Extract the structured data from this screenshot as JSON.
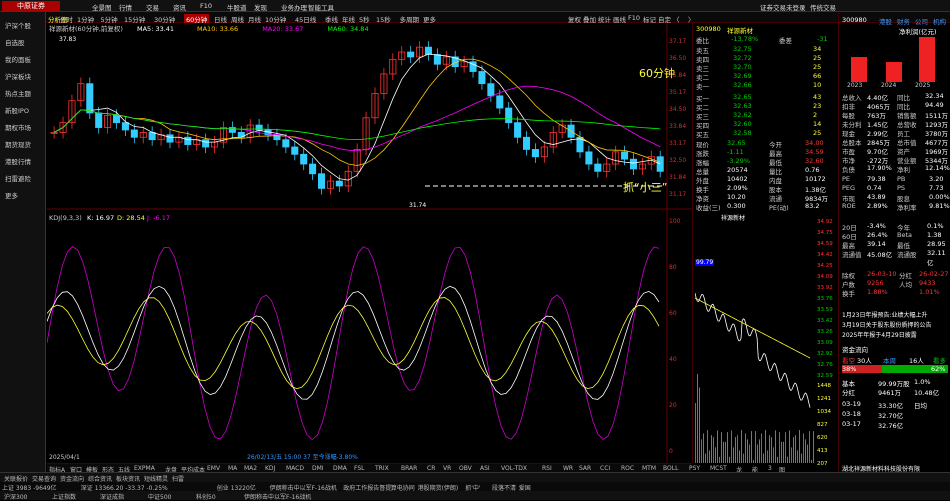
{
  "app": {
    "logo": "中原证券",
    "menus": [
      "全景图",
      "行情",
      "交易",
      "资讯",
      "F10",
      "牛股道",
      "发现",
      "业务办理",
      "智能工具"
    ],
    "right_menus": [
      "证券交易未登录",
      "传统交易"
    ]
  },
  "toolbar": {
    "ticker_label": "分析图",
    "timeframes": [
      "分时",
      "1分钟",
      "5分钟",
      "15分钟",
      "30分钟",
      "60分钟",
      "日线",
      "周线",
      "月线",
      "10分钟",
      "45日线",
      "季线",
      "年线",
      "5秒",
      "15秒",
      "多周期",
      "更多"
    ],
    "active_tf": "60分钟",
    "right_tools": [
      "复权",
      "叠加",
      "统计",
      "画线",
      "F10",
      "标记",
      "自定",
      "〈",
      "〉"
    ]
  },
  "sidebar": [
    "沪深个股",
    "自选股",
    "我的面板",
    "沪深板块",
    "热点主题",
    "新股IPO",
    "期权市场",
    "期货现货",
    "港股行情",
    "扫雷避险",
    "更多"
  ],
  "chart": {
    "title": "祥源新材(60分钟,前复权)",
    "ma": [
      {
        "label": "MA5: 33.41",
        "color": "#ffffff"
      },
      {
        "label": "MA10: 33.66",
        "color": "#ffcc00"
      },
      {
        "label": "MA20: 33.67",
        "color": "#ff00ff"
      },
      {
        "label": "MA60: 34.84",
        "color": "#00ff00"
      }
    ],
    "high_label": "37.83",
    "low_label": "31.74",
    "annotation_time": "60分钟",
    "annotation_grab": "抓“小三”",
    "kdj_label": "KDJ(9,3,3)",
    "k": "K: 16.97",
    "d": "D: 28.54",
    "j": "J: -6.17",
    "cursor_info": "26/02/13/五 15:00 37 至今涨幅-3.80%",
    "date_left": "2025/04/1",
    "y_ticks_price": [
      "37.17",
      "36.50",
      "35.84",
      "35.17",
      "34.50",
      "33.84",
      "33.17",
      "32.50",
      "31.84",
      "31.17"
    ],
    "y_ticks_kdj": [
      "100",
      "80",
      "60",
      "40",
      "20",
      "0"
    ]
  },
  "bottom_tabs": [
    "指标A",
    "窗口",
    "模板",
    "形态",
    "五线",
    "EXPMA",
    "龙盘",
    "平均成本",
    "EMV",
    "MA",
    "MA2",
    "KDJ",
    "MACD",
    "DMI",
    "DMA",
    "FSL",
    "TRIX",
    "BRAR",
    "CR",
    "VR",
    "OBV",
    "ASI",
    "VOL-TDX",
    "RSI",
    "WR",
    "SAR",
    "CCI",
    "ROC",
    "MTM",
    "BOLL",
    "PSY",
    "MCST",
    "龙线",
    "能量",
    "3",
    "图文"
  ],
  "quote": {
    "code": "300980",
    "name": "祥源新材",
    "wei_bi": "-13.78%",
    "wei_cha": "-31",
    "sells": [
      [
        "卖五",
        "32.75",
        "34"
      ],
      [
        "卖四",
        "32.72",
        "25"
      ],
      [
        "卖三",
        "32.70",
        "25"
      ],
      [
        "卖二",
        "32.69",
        "66"
      ],
      [
        "卖一",
        "32.66",
        "10"
      ]
    ],
    "buys": [
      [
        "买一",
        "32.65",
        "43"
      ],
      [
        "买二",
        "32.63",
        "23"
      ],
      [
        "买三",
        "32.62",
        "2"
      ],
      [
        "买四",
        "32.60",
        "14"
      ],
      [
        "买五",
        "32.58",
        "25"
      ]
    ],
    "stats": [
      [
        "现价",
        "32.65",
        "今开",
        "34.00"
      ],
      [
        "涨跌",
        "-1.11",
        "最高",
        "34.59"
      ],
      [
        "涨幅",
        "-3.29%",
        "最低",
        "32.60"
      ],
      [
        "总量",
        "20574",
        "量比",
        "0.76"
      ],
      [
        "外盘",
        "10402",
        "内盘",
        "10172"
      ],
      [
        "换手",
        "2.09%",
        "股本",
        "1.38亿"
      ],
      [
        "净资",
        "10.20",
        "流通",
        "9834万"
      ],
      [
        "收益(三)",
        "0.300",
        "PE(动)",
        "83.2"
      ]
    ],
    "axis": [
      "34.92",
      "34.75",
      "34.59",
      "34.42",
      "34.25",
      "34.09",
      "33.92",
      "33.76",
      "33.59",
      "33.42",
      "33.26",
      "33.09",
      "32.92",
      "32.76",
      "32.59"
    ],
    "vol_axis": [
      "1448",
      "1241",
      "1034",
      "827",
      "620",
      "413",
      "207"
    ],
    "mini_label": "祥源新材",
    "mini_price": "99.79"
  },
  "info": {
    "code": "300980",
    "tabs": [
      "港股",
      "财务",
      "公司",
      "机构"
    ],
    "profit_label": "净利润(亿元)",
    "years": [
      "2023",
      "2024",
      "2025"
    ],
    "rows": [
      [
        "总收入",
        "4.40亿",
        "同比",
        "32.34"
      ],
      [
        "扣非",
        "4065万",
        "同比",
        "94.49"
      ],
      [
        "每股",
        "763万",
        "销售额",
        "1511万"
      ],
      [
        "未分利",
        "1.45亿",
        "总营收",
        "1293万"
      ],
      [
        "现金",
        "2.99亿",
        "员工",
        "3780万"
      ],
      [
        "总股本",
        "2845万",
        "总市值",
        "4677万"
      ],
      [
        "市盈",
        "9.70亿",
        "资产",
        "1969万"
      ],
      [
        "市净",
        "-272万",
        "营业额",
        "5344万"
      ],
      [
        "负债",
        "17.90%",
        "净利",
        "12.14%"
      ]
    ],
    "val": [
      [
        "PE",
        "79.38",
        "PB",
        "3.20"
      ],
      [
        "PEG",
        "0.74",
        "PS",
        "7.73"
      ],
      [
        "市现",
        "43.89",
        "股息",
        "0.00%"
      ],
      [
        "ROE",
        "2.89%",
        "净利率",
        "9.81%"
      ]
    ],
    "returns": [
      [
        "20日",
        "-3.4%",
        "今年",
        "0.1%"
      ],
      [
        "60日",
        "26.4%",
        "Beta",
        "1.38"
      ],
      [
        "最高",
        "39.14",
        "最低",
        "28.95"
      ],
      [
        "流通值",
        "45.08亿",
        "流通股",
        "32.11亿"
      ]
    ],
    "dates": [
      [
        "除权",
        "26-03-10",
        "分红",
        "26-02-27"
      ],
      [
        "户数",
        "9256",
        "人均",
        "9433"
      ],
      [
        "换手",
        "1.88%",
        "",
        "1.01%"
      ]
    ],
    "news": [
      "1月23日年报预告:业绩大幅上升",
      "3月19日关于股东股份质押的公告",
      "2025年年报于4月29日披露"
    ],
    "fund": "资金流向",
    "sentiment": {
      "bear": "38%",
      "bull": "62%",
      "label_l": "看空",
      "label_r": "看多",
      "mid": "本周",
      "count_l": "30人",
      "count_r": "16人"
    },
    "trade": [
      [
        "基本",
        "99.99万股",
        "1.0%"
      ],
      [
        "分红",
        "9461万",
        "10.48亿"
      ]
    ],
    "ticks": [
      [
        "03-19",
        "33.30亿",
        "日均"
      ],
      [
        "03-18",
        "32.70亿",
        ""
      ],
      [
        "03-17",
        "32.76亿",
        ""
      ]
    ],
    "bottom_info": [
      "湖北祥源新材料科技股份有限",
      "公司 隆盛 - 有限公司"
    ]
  },
  "footer1": [
    "关联报价",
    "交易查询",
    "资金流向",
    "综合资讯",
    "板块资讯",
    "短线精灵",
    "扫雷"
  ],
  "footer2": [
    "上证 3983 -9649亿",
    "深证 13366.20 -33.37 -0.25%",
    "创业 13220亿",
    "伊朗称击中以军F-16战机",
    "政府工作报告督提",
    "算电协同",
    "港股期货(伊朗)",
    "抓'中'",
    "段落不清",
    "爱国"
  ],
  "footer3": [
    "沪深300",
    "上证指数",
    "深证成指",
    "中证500",
    "科创50",
    "伊朗称击中以军F-16战机"
  ]
}
